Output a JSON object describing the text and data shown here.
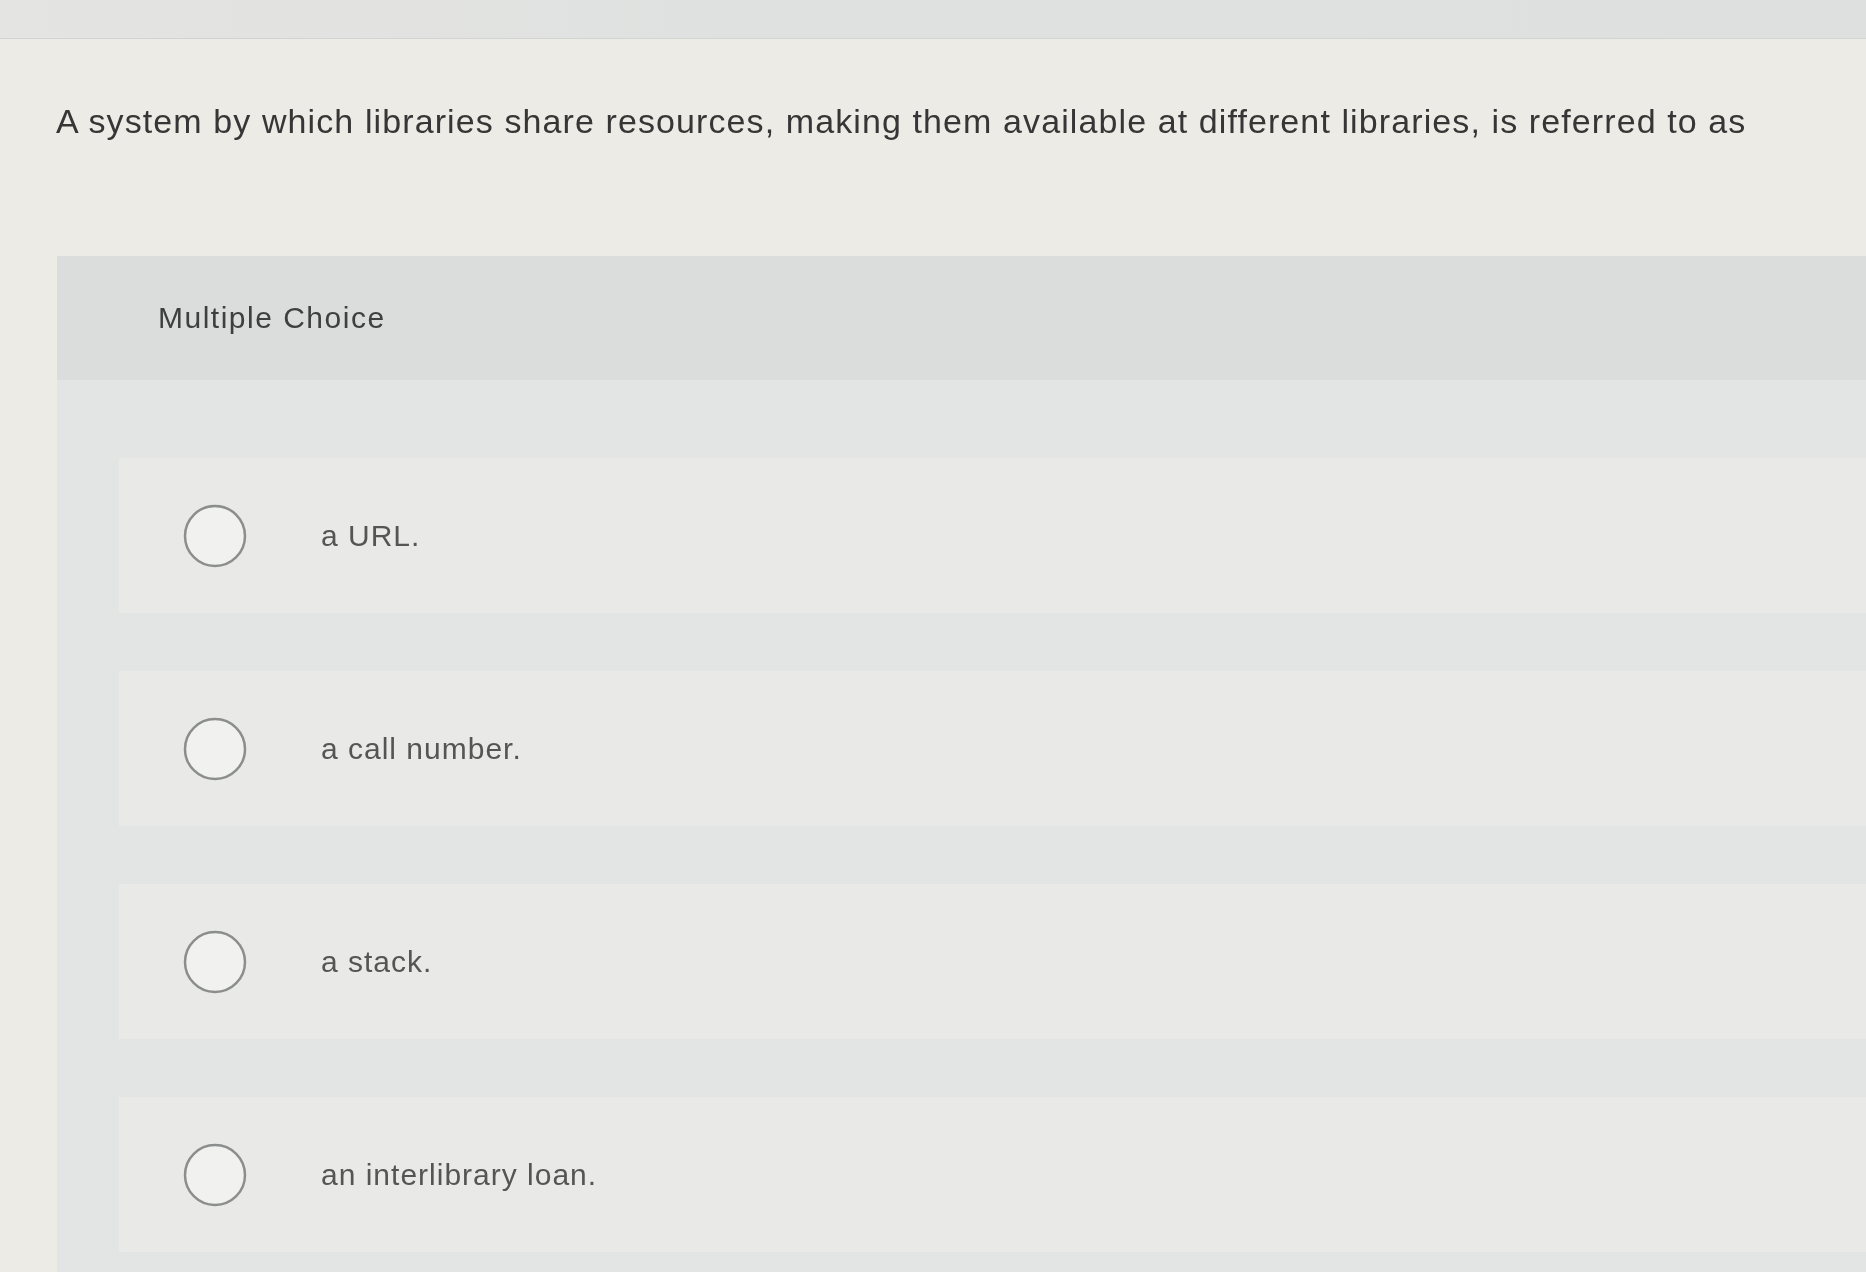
{
  "question": {
    "text": "A system by which libraries share resources, making them available at different libraries, is referred to as"
  },
  "choices": {
    "heading": "Multiple Choice",
    "options": [
      {
        "label": "a URL.",
        "selected": false
      },
      {
        "label": "a call number.",
        "selected": false
      },
      {
        "label": "a stack.",
        "selected": false
      },
      {
        "label": "an interlibrary loan.",
        "selected": false
      }
    ]
  }
}
